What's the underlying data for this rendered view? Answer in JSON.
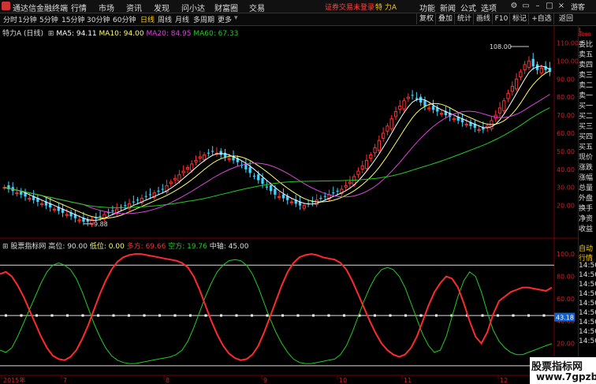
{
  "titlebar": {
    "app_name": "通达信金融终端",
    "menus": [
      "行情",
      "市场",
      "资讯",
      "发现",
      "问小达",
      "财富圈",
      "交易"
    ],
    "warning": "证券交易未登录",
    "stock_name": "特 力A",
    "right_menus": [
      "功能",
      "新闻",
      "公式",
      "选项"
    ],
    "guest": "游客"
  },
  "toolbar": {
    "periods": [
      "分时",
      "1分钟",
      "5分钟",
      "15分钟",
      "30分钟",
      "60分钟",
      "日线",
      "周线",
      "月线",
      "多周期",
      "更多"
    ],
    "active_period": "日线",
    "right_buttons": [
      "复权",
      "叠加",
      "统计",
      "画线",
      "F10",
      "标记",
      "+自选",
      "返回"
    ]
  },
  "chart_info": {
    "stock": "特力A (日线)",
    "ma5": "MA5: 94.11",
    "ma10": "MA10: 94.00",
    "ma20": "MA20: 84.95",
    "ma60": "MA60: 67.33",
    "colors": {
      "ma5": "#ffffff",
      "ma10": "#ffff66",
      "ma20": "#dd44dd",
      "ma60": "#22cc22"
    }
  },
  "indicator_info": {
    "name": "股票指标网",
    "high": "高位: 90.00",
    "low": "低位: 0.00",
    "long_label": "多方: 69.66",
    "short_label": "空方: 19.76",
    "mid": "中轴: 45.00",
    "current_value": "43.18"
  },
  "price_axis": [
    "110.00",
    "100.00",
    "90.00",
    "80.00",
    "70.00",
    "60.00",
    "50.00",
    "40.00",
    "30.00",
    "20.00"
  ],
  "ind_axis": [
    "100.0",
    "80.00",
    "60.00",
    "40.00",
    "20.00"
  ],
  "price_annotations": {
    "high": "108.00",
    "low": "9.88"
  },
  "date_axis": [
    "2015年",
    "7",
    "8",
    "9",
    "10",
    "11",
    "12"
  ],
  "right_panel": {
    "top_labels": [
      "L",
      "8000"
    ],
    "items": [
      "委比",
      "卖五",
      "卖四",
      "卖三",
      "卖二",
      "卖一",
      "买一",
      "买二",
      "买三",
      "买四",
      "买五",
      "现价",
      "涨跌",
      "涨幅",
      "总量",
      "外盘",
      "换手",
      "净资",
      "收益"
    ],
    "lower_items": [
      "自动",
      "行情",
      "14:50",
      "14:50",
      "14:50",
      "14:50",
      "14:50",
      "14:50",
      "14:50",
      "14:50",
      "14:50"
    ]
  },
  "brand": {
    "line1": "股票指标网",
    "line2": "www.7gpzb.com"
  },
  "chart_data": [
    {
      "type": "candlestick",
      "title": "特力A (日线)",
      "ylim": [
        5,
        115
      ],
      "x": [
        "2015-06",
        "2015-07",
        "2015-08",
        "2015-09",
        "2015-10",
        "2015-11",
        "2015-12"
      ],
      "annotations": [
        {
          "label": "108.00",
          "value": 108.0
        },
        {
          "label": "9.88",
          "value": 9.88
        }
      ],
      "series": [
        {
          "name": "close",
          "values": [
            30,
            29,
            28,
            27,
            26,
            25,
            24,
            23,
            22,
            21,
            20,
            19,
            18,
            17,
            16,
            15,
            14,
            13,
            12,
            11,
            11,
            12,
            13,
            14,
            15,
            16,
            17,
            18,
            19,
            20,
            21,
            22,
            23,
            24,
            25,
            26,
            27,
            28,
            29,
            31,
            33,
            35,
            37,
            39,
            41,
            43,
            45,
            47,
            48,
            49,
            50,
            49,
            48,
            47,
            46,
            45,
            44,
            42,
            40,
            38,
            36,
            34,
            32,
            30,
            28,
            26,
            25,
            24,
            23,
            22,
            21,
            20,
            20,
            21,
            22,
            23,
            24,
            25,
            26,
            27,
            28,
            29,
            31,
            33,
            36,
            39,
            42,
            45,
            48,
            52,
            56,
            60,
            64,
            68,
            72,
            75,
            78,
            80,
            81,
            79,
            77,
            75,
            74,
            73,
            72,
            71,
            70,
            69,
            68,
            67,
            66,
            65,
            64,
            63,
            62,
            62,
            64,
            67,
            70,
            74,
            78,
            82,
            86,
            90,
            94,
            98,
            100,
            97,
            95,
            96,
            95,
            94
          ]
        },
        {
          "name": "MA5",
          "values": [
            94.11
          ]
        },
        {
          "name": "MA10",
          "values": [
            94.0
          ]
        },
        {
          "name": "MA20",
          "values": [
            84.95
          ]
        },
        {
          "name": "MA60",
          "values": [
            67.33
          ]
        }
      ]
    },
    {
      "type": "line",
      "title": "股票指标网",
      "ylim": [
        -5,
        105
      ],
      "series": [
        {
          "name": "多方",
          "values": [
            82,
            84,
            80,
            72,
            62,
            50,
            38,
            26,
            16,
            9,
            6,
            5,
            8,
            14,
            24,
            36,
            50,
            64,
            76,
            86,
            93,
            97,
            99,
            100,
            100,
            99,
            98,
            97,
            96,
            95,
            94,
            92,
            88,
            80,
            68,
            54,
            40,
            28,
            18,
            11,
            7,
            5,
            6,
            10,
            18,
            30,
            44,
            58,
            72,
            84,
            92,
            97,
            99,
            100,
            99,
            97,
            96,
            95,
            92,
            86,
            76,
            64,
            52,
            40,
            29,
            20,
            14,
            10,
            8,
            10,
            16,
            26,
            40,
            54,
            66,
            74,
            80,
            78,
            70,
            56,
            40,
            26,
            20,
            30,
            46,
            58,
            62,
            66,
            68,
            70,
            70,
            69,
            68,
            67,
            70
          ]
        },
        {
          "name": "空方",
          "values": [
            14,
            12,
            16,
            26,
            38,
            50,
            62,
            74,
            84,
            90,
            92,
            90,
            86,
            78,
            66,
            52,
            38,
            26,
            16,
            9,
            5,
            3,
            2,
            2,
            3,
            4,
            5,
            6,
            7,
            8,
            10,
            14,
            22,
            34,
            48,
            62,
            74,
            84,
            90,
            94,
            95,
            94,
            90,
            82,
            70,
            56,
            42,
            30,
            20,
            12,
            6,
            3,
            2,
            2,
            3,
            4,
            5,
            6,
            10,
            18,
            30,
            44,
            58,
            70,
            80,
            86,
            88,
            86,
            80,
            70,
            56,
            42,
            28,
            18,
            12,
            14,
            26,
            44,
            62,
            76,
            84,
            80,
            66,
            48,
            32,
            22,
            16,
            12,
            10,
            10,
            12,
            14,
            16,
            18,
            19.76
          ]
        },
        {
          "name": "高位",
          "values": [
            90
          ]
        },
        {
          "name": "低位",
          "values": [
            0
          ]
        },
        {
          "name": "中轴",
          "values": [
            45
          ]
        }
      ]
    }
  ]
}
